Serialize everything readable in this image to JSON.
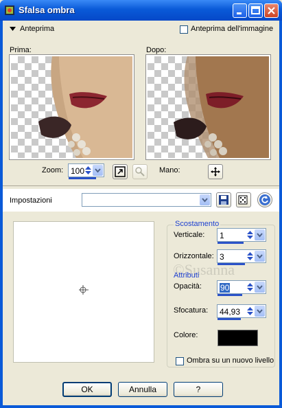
{
  "window": {
    "title": "Sfalsa ombra",
    "controls": {
      "minimize": "minimize-icon",
      "maximize": "maximize-icon",
      "close": "close-icon"
    }
  },
  "preview": {
    "section_label": "Anteprima",
    "image_preview_label": "Anteprima dell'immagine",
    "image_preview_checked": false,
    "before_label": "Prima:",
    "after_label": "Dopo:",
    "zoom_label": "Zoom:",
    "zoom_value": "100",
    "pan_label": "Mano:"
  },
  "settings": {
    "label": "Impostazioni",
    "preset_value": ""
  },
  "offset": {
    "title": "Scostamento",
    "vertical_label": "Verticale:",
    "vertical_value": "1",
    "horizontal_label": "Orizzontale:",
    "horizontal_value": "3"
  },
  "attributes": {
    "title": "Attributi",
    "opacity_label": "Opacità:",
    "opacity_value": "90",
    "blur_label": "Sfocatura:",
    "blur_value": "44,93",
    "color_label": "Colore:",
    "color_value": "#000000"
  },
  "new_layer": {
    "label": "Ombra su un nuovo livello",
    "checked": false
  },
  "watermark": "©Susanna",
  "buttons": {
    "ok": "OK",
    "cancel": "Annulla",
    "help": "?"
  },
  "colors": {
    "title_bar": "#0a5ad8",
    "dialog": "#ece9d8",
    "group_title": "#1c3fd0",
    "slider": "#2a52c8"
  }
}
